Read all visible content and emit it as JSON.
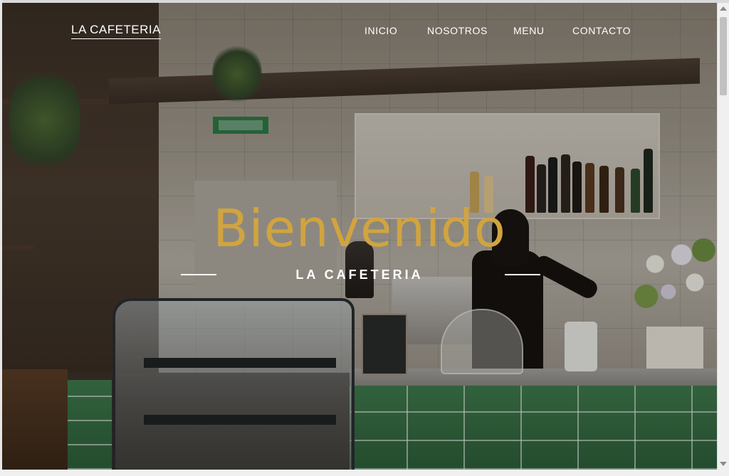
{
  "brand": {
    "name": "LA CAFETERIA"
  },
  "nav": {
    "items": [
      {
        "label": "INICIO"
      },
      {
        "label": "NOSOTROS"
      },
      {
        "label": "MENU"
      },
      {
        "label": "CONTACTO"
      }
    ]
  },
  "hero": {
    "title": "Bienvenido",
    "subtitle": "LA CAFETERIA"
  },
  "colors": {
    "accent": "#d1a43f",
    "nav_text": "#ffffff"
  }
}
